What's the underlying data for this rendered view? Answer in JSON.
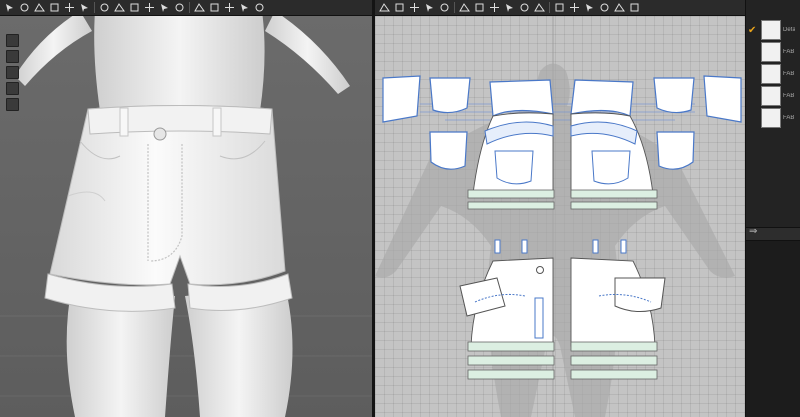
{
  "toolbar_3d": {
    "icons": [
      "select-icon",
      "move-icon",
      "pin-icon",
      "fold-icon",
      "brush-icon",
      "tack-icon",
      "grid-icon",
      "button-icon",
      "zipper-icon",
      "ruler-icon",
      "topstitch-icon",
      "sphere-icon",
      "avatar-icon",
      "measure-icon",
      "camera-icon",
      "light-icon",
      "render-icon"
    ]
  },
  "toolbar_2d": {
    "icons": [
      "transform-pattern-icon",
      "edit-point-icon",
      "edit-curve-icon",
      "edit-pattern-icon",
      "add-point-icon",
      "polygon-icon",
      "rectangle-icon",
      "circle-icon",
      "segment-sewing-icon",
      "free-sewing-icon",
      "fold-arrange-icon",
      "internal-line-icon",
      "dart-icon",
      "grade-icon",
      "pleat-icon",
      "trace-icon",
      "zoom-icon"
    ]
  },
  "view_side_icons": [
    "display-avatar-icon",
    "avatar-visibility-icon",
    "texture-icon",
    "line-icon",
    "avatar-figure-icon"
  ],
  "object_browser": {
    "accent": "#e8a31b",
    "fabrics": [
      {
        "label": "Default",
        "selected": true
      },
      {
        "label": "FAB",
        "selected": false
      },
      {
        "label": "FAB",
        "selected": false
      },
      {
        "label": "FAB",
        "selected": false
      },
      {
        "label": "FAB",
        "selected": false
      }
    ],
    "arrow": "⇒"
  },
  "colors": {
    "toolbar_bg": "#2b2b2b",
    "viewport_3d_bg": "#656565",
    "viewport_2d_bg": "#c4c4c4",
    "pattern_outline_selected": "#4a78c8",
    "waistband_fill": "#dcefe2"
  }
}
